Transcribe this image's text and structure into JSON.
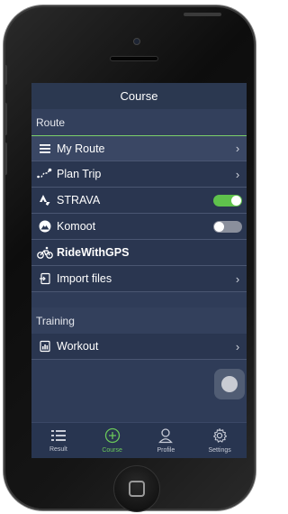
{
  "header": {
    "title": "Course"
  },
  "sections": {
    "route": {
      "title": "Route",
      "items": [
        {
          "label": "My Route",
          "icon": "list-icon",
          "trailing": "chevron"
        },
        {
          "label": "Plan Trip",
          "icon": "plan-trip-icon",
          "trailing": "chevron"
        },
        {
          "label": "STRAVA",
          "icon": "strava-icon",
          "trailing": "toggle",
          "toggle_on": true
        },
        {
          "label": "Komoot",
          "icon": "komoot-icon",
          "trailing": "toggle",
          "toggle_on": false
        },
        {
          "label": "RideWithGPS",
          "icon": "ridewithgps-icon",
          "trailing": "none"
        },
        {
          "label": "Import files",
          "icon": "import-icon",
          "trailing": "chevron"
        }
      ]
    },
    "training": {
      "title": "Training",
      "items": [
        {
          "label": "Workout",
          "icon": "workout-icon",
          "trailing": "chevron"
        }
      ]
    }
  },
  "tabbar": {
    "tabs": [
      {
        "label": "Result",
        "icon": "result-list-icon",
        "active": false
      },
      {
        "label": "Course",
        "icon": "course-plus-icon",
        "active": true
      },
      {
        "label": "Profile",
        "icon": "profile-icon",
        "active": false
      },
      {
        "label": "Settings",
        "icon": "settings-gear-icon",
        "active": false
      }
    ]
  },
  "colors": {
    "accent": "#6ac75a",
    "background": "#2f3c58",
    "toggle_on": "#5fc24c",
    "toggle_off": "#8a8f9c"
  }
}
